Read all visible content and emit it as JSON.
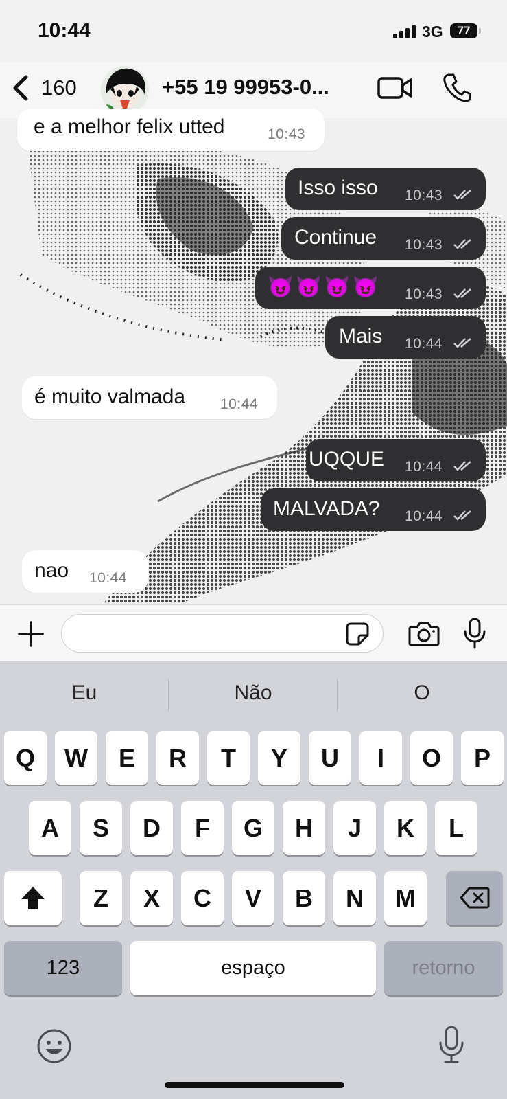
{
  "status_bar": {
    "time": "10:44",
    "network": "3G",
    "battery": "77"
  },
  "header": {
    "back_count": "160",
    "contact": "+55 19 99953-0..."
  },
  "messages": [
    {
      "dir": "in",
      "text": "e a melhor felix utted",
      "time": "10:43"
    },
    {
      "dir": "out",
      "text": "Isso isso",
      "time": "10:43"
    },
    {
      "dir": "out",
      "text": "Continue",
      "time": "10:43"
    },
    {
      "dir": "out",
      "text": "😈😈😈😈",
      "time": "10:43"
    },
    {
      "dir": "out",
      "text": "Mais",
      "time": "10:44"
    },
    {
      "dir": "in",
      "text": "é muito valmada",
      "time": "10:44"
    },
    {
      "dir": "out",
      "text": "UQQUE",
      "time": "10:44"
    },
    {
      "dir": "out",
      "text": "MALVADA?",
      "time": "10:44"
    },
    {
      "dir": "in",
      "text": "nao",
      "time": "10:44"
    }
  ],
  "input": {
    "value": ""
  },
  "keyboard": {
    "suggestions": [
      "Eu",
      "Não",
      "O"
    ],
    "row1": [
      "Q",
      "W",
      "E",
      "R",
      "T",
      "Y",
      "U",
      "I",
      "O",
      "P"
    ],
    "row2": [
      "A",
      "S",
      "D",
      "F",
      "G",
      "H",
      "J",
      "K",
      "L"
    ],
    "row3": [
      "Z",
      "X",
      "C",
      "V",
      "B",
      "N",
      "M"
    ],
    "numbers_label": "123",
    "space_label": "espaço",
    "return_label": "retorno"
  },
  "colors": {
    "outgoing_bubble": "#2f2f31",
    "incoming_bubble": "#ffffff",
    "keyboard_bg": "#d2d4d9"
  },
  "icons": [
    "back-chevron-icon",
    "video-call-icon",
    "phone-icon",
    "plus-icon",
    "sticker-icon",
    "camera-icon",
    "microphone-icon",
    "shift-icon",
    "backspace-icon",
    "emoji-icon",
    "dictation-mic-icon",
    "read-receipt-icon"
  ]
}
